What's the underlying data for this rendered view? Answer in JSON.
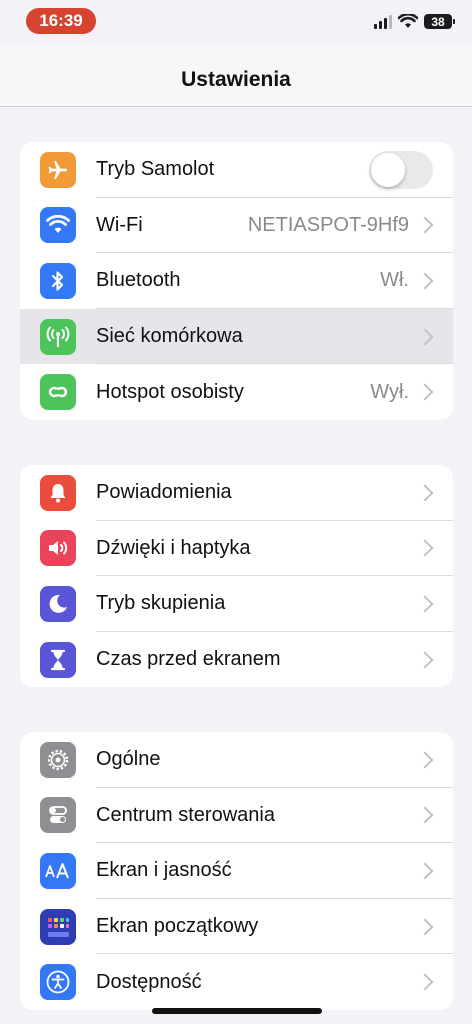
{
  "status": {
    "time": "16:39",
    "battery": "38"
  },
  "nav": {
    "title": "Ustawienia"
  },
  "groups": [
    {
      "rows": [
        {
          "label": "Tryb Samolot",
          "icon": "airplane-icon",
          "color": "#f19a37",
          "toggle": false
        },
        {
          "label": "Wi-Fi",
          "value": "NETIASPOT-9Hf9",
          "icon": "wifi-icon",
          "color": "#3478f6"
        },
        {
          "label": "Bluetooth",
          "value": "Wł.",
          "icon": "bluetooth-icon",
          "color": "#3478f6"
        },
        {
          "label": "Sieć komórkowa",
          "icon": "antenna-icon",
          "color": "#4cc45b",
          "highlighted": true
        },
        {
          "label": "Hotspot osobisty",
          "value": "Wył.",
          "icon": "hotspot-icon",
          "color": "#4cc45b"
        }
      ]
    },
    {
      "rows": [
        {
          "label": "Powiadomienia",
          "icon": "bell-icon",
          "color": "#eb4d3d"
        },
        {
          "label": "Dźwięki i haptyka",
          "icon": "speaker-icon",
          "color": "#eb445a"
        },
        {
          "label": "Tryb skupienia",
          "icon": "moon-icon",
          "color": "#5a55d6"
        },
        {
          "label": "Czas przed ekranem",
          "icon": "hourglass-icon",
          "color": "#5a55d6"
        }
      ]
    },
    {
      "rows": [
        {
          "label": "Ogólne",
          "icon": "gear-icon",
          "color": "#8e8e93"
        },
        {
          "label": "Centrum sterowania",
          "icon": "switches-icon",
          "color": "#8e8e93"
        },
        {
          "label": "Ekran i jasność",
          "icon": "text-size-icon",
          "color": "#3478f6"
        },
        {
          "label": "Ekran początkowy",
          "icon": "home-grid-icon",
          "color": "#2f3db5"
        },
        {
          "label": "Dostępność",
          "icon": "accessibility-icon",
          "color": "#3478f6"
        }
      ]
    }
  ]
}
